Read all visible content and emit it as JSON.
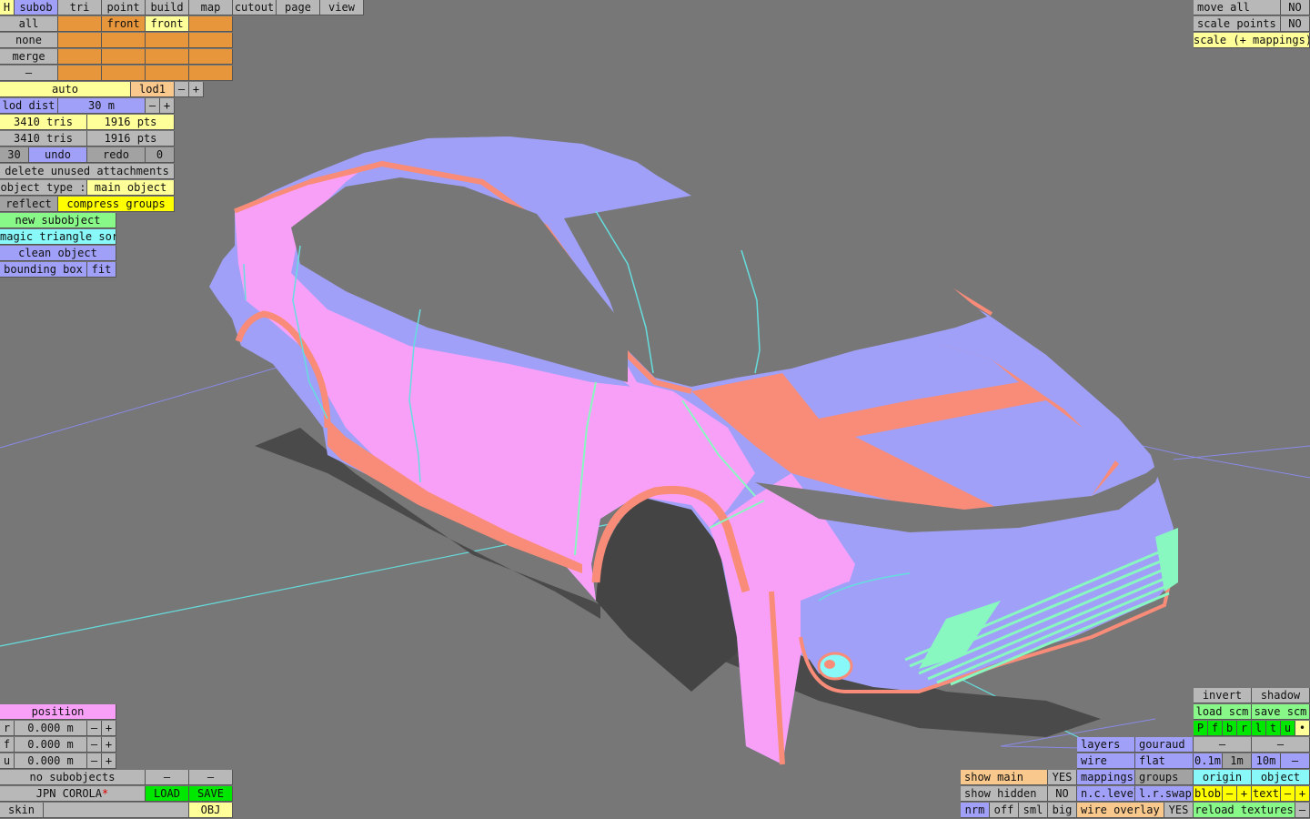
{
  "top_menu": {
    "h": "H",
    "items": [
      "subob",
      "tri",
      "point",
      "build",
      "map",
      "cutout",
      "page",
      "view"
    ]
  },
  "subob_panel": {
    "rows": [
      [
        "all",
        "",
        "front",
        "front",
        ""
      ],
      [
        "none",
        "",
        "",
        "",
        ""
      ],
      [
        "merge",
        "",
        "",
        "",
        ""
      ],
      [
        "–",
        "",
        "",
        "",
        ""
      ]
    ]
  },
  "lod": {
    "auto": "auto",
    "lod1": "lod1",
    "minus": "–",
    "plus": "+",
    "dist_label": "lod dist",
    "dist_value": "30 m"
  },
  "counts": {
    "tris1": "3410 tris",
    "pts1": "1916 pts",
    "tris2": "3410 tris",
    "pts2": "1916 pts"
  },
  "undo": {
    "n": "30",
    "undo": "undo",
    "redo": "redo",
    "redo_n": "0"
  },
  "actions": {
    "delete_unused": "delete unused attachments",
    "object_type_label": "object type :",
    "object_type_value": "main object",
    "reflect": "reflect",
    "compress": "compress groups",
    "new_subobject": "new subobject",
    "magic_sort": "magic triangle sort",
    "clean": "clean object",
    "bbox": "bounding box",
    "fit": "fit"
  },
  "top_right": {
    "move_all": "move all",
    "move_all_v": "NO",
    "scale_points": "scale points",
    "scale_points_v": "NO",
    "scale_mappings": "scale (+ mappings)"
  },
  "position": {
    "title": "position",
    "rows": [
      {
        "axis": "r",
        "value": "0.000 m"
      },
      {
        "axis": "f",
        "value": "0.000 m"
      },
      {
        "axis": "u",
        "value": "0.000 m"
      }
    ],
    "minus": "–",
    "plus": "+"
  },
  "bottom_left": {
    "no_subobjects": "no subobjects",
    "dash": "–",
    "file": "JPN COROLA",
    "star": "*",
    "load": "LOAD",
    "save": "SAVE",
    "skin": "skin",
    "obj": "OBJ"
  },
  "bottom_mid": {
    "show_main": "show main",
    "show_main_v": "YES",
    "show_hidden": "show hidden",
    "show_hidden_v": "NO",
    "nrm": "nrm",
    "off": "off",
    "sml": "sml",
    "big": "big"
  },
  "render": {
    "layers": "layers",
    "gouraud": "gouraud",
    "wire": "wire",
    "flat": "flat",
    "mappings": "mappings",
    "groups": "groups",
    "nclevel": "n.c.level",
    "lrswap": "l.r.swap",
    "wire_overlay": "wire overlay",
    "wire_overlay_v": "YES"
  },
  "bottom_right": {
    "invert": "invert",
    "shadow": "shadow",
    "load_scm": "load scm",
    "save_scm": "save scm",
    "flags": [
      "P",
      "f",
      "b",
      "r",
      "l",
      "t",
      "u",
      "•"
    ],
    "dash": "–",
    "s01": "0.1m",
    "s1": "1m",
    "s10": "10m",
    "origin": "origin",
    "object": "object",
    "blob": "blob",
    "text": "text",
    "minus": "–",
    "plus": "+",
    "reload": "reload textures"
  },
  "colors": {
    "bg": "#777777",
    "lavender": "#a0a0f8",
    "pink": "#f8a0f8",
    "salmon": "#f88c78",
    "shadow": "#484848",
    "grid": "#8888ee",
    "cyan": "#66dddd"
  }
}
